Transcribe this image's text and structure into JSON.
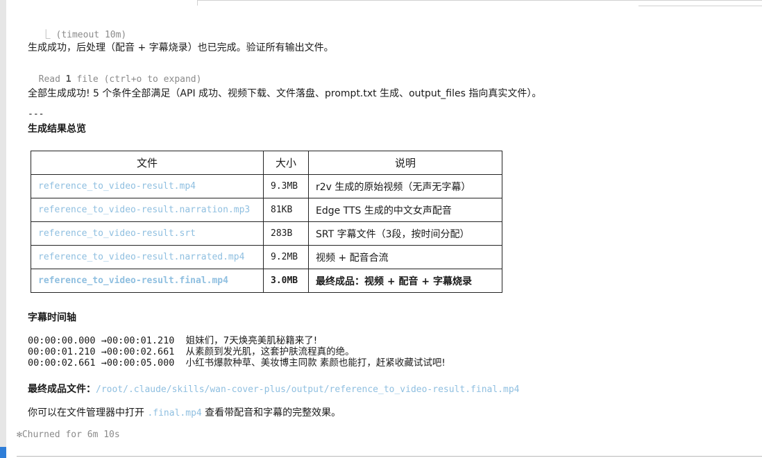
{
  "tool_output": {
    "bracket": "⎿",
    "timeout_text": "(timeout 10m)"
  },
  "status_line": "生成成功，后处理（配音 + 字幕烧录）也已完成。验证所有输出文件。",
  "read_line": {
    "prefix": "Read ",
    "count": "1",
    "suffix": " file (ctrl+o to expand)"
  },
  "summary_line": "全部生成成功! 5 个条件全部满足（API 成功、视频下载、文件落盘、prompt.txt 生成、output_files 指向真实文件）。",
  "separator": "---",
  "results_heading": "生成结果总览",
  "table": {
    "headers": [
      "文件",
      "大小",
      "说明"
    ],
    "rows": [
      {
        "file": "reference_to_video-result.mp4",
        "size": "9.3MB",
        "desc": "r2v 生成的原始视频（无声无字幕）"
      },
      {
        "file": "reference_to_video-result.narration.mp3",
        "size": "81KB",
        "desc": "Edge TTS 生成的中文女声配音"
      },
      {
        "file": "reference_to_video-result.srt",
        "size": "283B",
        "desc": "SRT 字幕文件（3段，按时间分配）"
      },
      {
        "file": "reference_to_video-result.narrated.mp4",
        "size": "9.2MB",
        "desc": "视频 + 配音合流"
      },
      {
        "file": "reference_to_video-result.final.mp4",
        "size": "3.0MB",
        "desc": "最终成品：视频 + 配音 + 字幕烧录"
      }
    ]
  },
  "timeline_heading": "字幕时间轴",
  "timeline": [
    {
      "start": "00:00:00.000",
      "arrow": "→",
      "end": "00:00:01.210",
      "text": "姐妹们，7天焕亮美肌秘籍来了!"
    },
    {
      "start": "00:00:01.210",
      "arrow": "→",
      "end": "00:00:02.661",
      "text": "从素颜到发光肌，这套护肤流程真的绝。"
    },
    {
      "start": "00:00:02.661",
      "arrow": "→",
      "end": "00:00:05.000",
      "text": "小红书爆款种草、美妆博主同款 素颜也能打，赶紧收藏试试吧!"
    }
  ],
  "final_file": {
    "label": "最终成品文件：",
    "path": "/root/.claude/skills/wan-cover-plus/output/reference_to_video-result.final.mp4"
  },
  "open_hint": {
    "before": "你可以在文件管理器中打开 ",
    "code": ".final.mp4",
    "after": " 查看带配音和字幕的完整效果。"
  },
  "churned": {
    "icon": "asterisk-icon",
    "glyph": "✻",
    "text": "Churned for 6m 10s"
  },
  "colors": {
    "link": "#8fbfe0",
    "muted": "#8a8a8a",
    "accent": "#2f7ed8"
  }
}
